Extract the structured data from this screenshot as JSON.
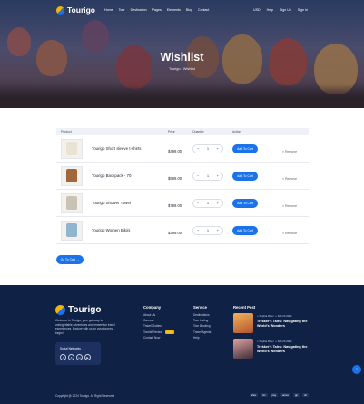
{
  "colors": {
    "accent": "#1a73e8",
    "footer_bg": "#0f2145",
    "brand_yellow": "#f4b400"
  },
  "header": {
    "logo_text": "Tourigo",
    "menu": [
      "Home",
      "Tour",
      "Destination",
      "Pages",
      "Elements",
      "Blog",
      "Contact"
    ],
    "right": [
      "USD",
      "Help",
      "Sign Up",
      "Sign In"
    ]
  },
  "hero": {
    "title": "Wishlist",
    "breadcrumb": "Tourigo - Wishlist"
  },
  "table": {
    "headers": {
      "product": "Product",
      "price": "Price",
      "quantity": "Quantity",
      "action": "Action"
    },
    "rows": [
      {
        "name": "Tourigo Short sleeve t-shirts",
        "price": "$499.00",
        "qty": "1",
        "action": "Add To Cart",
        "remove": "Remove",
        "color": "#e9e3d6"
      },
      {
        "name": "Tourigo Backpack - 70",
        "price": "$999.00",
        "qty": "1",
        "action": "Add To Cart",
        "remove": "Remove",
        "color": "#a2673a"
      },
      {
        "name": "Tourigo Shower Towel",
        "price": "$799.00",
        "qty": "1",
        "action": "Add To Cart",
        "remove": "Remove",
        "color": "#c9c2b7"
      },
      {
        "name": "Tourigo Women Bikini",
        "price": "$399.00",
        "qty": "1",
        "action": "Add To Cart",
        "remove": "Remove",
        "color": "#8fb5cf"
      }
    ],
    "go_to_cart": "Go To Cart"
  },
  "footer": {
    "logo_text": "Tourigo",
    "about": "Welcome to Tourigo, your gateway to unforgettable adventures and immersive travel experiences. Explore with us on your journey begin!",
    "social_title": "Social Networks",
    "social_icons": [
      "f",
      "X",
      "in",
      "yt"
    ],
    "company_title": "Company",
    "company_links": [
      "About Us",
      "Careers",
      "Travel Guides",
      "Tourist Review",
      "Contact Now"
    ],
    "hire_badge": "Hire",
    "service_title": "Service",
    "service_links": [
      "Destinations",
      "Tour Listing",
      "Tour Booking",
      "Travel Agents",
      "Help"
    ],
    "recent_title": "Recent Post",
    "posts": [
      {
        "author": "Sophia Miller",
        "date": "Feb 20 2024",
        "title": "Trekker's Tales: Navigating the World's Wonders"
      },
      {
        "author": "Sophia Miller",
        "date": "Feb 20 2024",
        "title": "Trekker's Tales: Navigating the World's Wonders"
      }
    ],
    "copyright": "Copyright @ 2024 Tourigo. All Right Reserved",
    "payments": [
      "visa",
      "mc",
      "pay",
      "amex",
      "gp",
      "dc"
    ]
  }
}
